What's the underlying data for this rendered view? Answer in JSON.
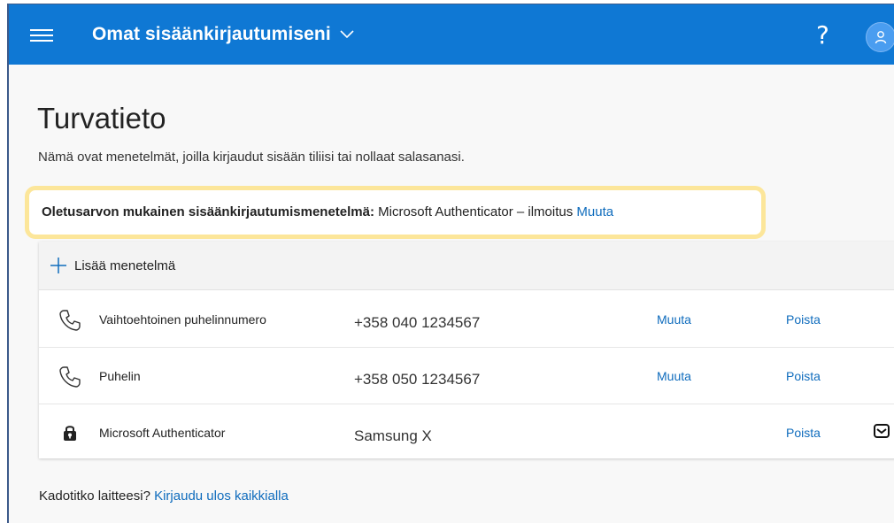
{
  "header": {
    "menu_icon": "hamburger-icon",
    "app_title": "Omat sisäänkirjautumiseni",
    "title_dropdown_icon": "chevron-down-icon",
    "help_label": "?",
    "avatar_icon": "person-icon",
    "brand_color": "#0f78d4"
  },
  "page": {
    "title": "Turvatieto",
    "subtitle": "Nämä ovat menetelmät, joilla kirjaudut sisään tiliisi tai nollaat salasanasi."
  },
  "default_method": {
    "label": "Oletusarvon mukainen sisäänkirjautumismenetelmä:",
    "value": "Microsoft Authenticator – ilmoitus",
    "change_link": "Muuta",
    "highlight_color": "#fce69a"
  },
  "methods": {
    "add_label": "Lisää menetelmä",
    "add_icon": "plus-icon",
    "rows": [
      {
        "icon": "phone-icon",
        "name": "Vaihtoehtoinen puhelinnumero",
        "value": "+358 040 1234567",
        "change": "Muuta",
        "delete": "Poista"
      },
      {
        "icon": "phone-icon",
        "name": "Puhelin",
        "value": "+358 050 1234567",
        "change": "Muuta",
        "delete": "Poista"
      },
      {
        "icon": "authenticator-lock-icon",
        "name": "Microsoft Authenticator",
        "value": "Samsung X",
        "change": "",
        "delete": "Poista",
        "extra_icon": "mail-icon"
      }
    ]
  },
  "footer": {
    "question": "Kadotitko laitteesi?",
    "signout_link": "Kirjaudu ulos kaikkialla"
  },
  "colors": {
    "link": "#0f6cbd"
  }
}
